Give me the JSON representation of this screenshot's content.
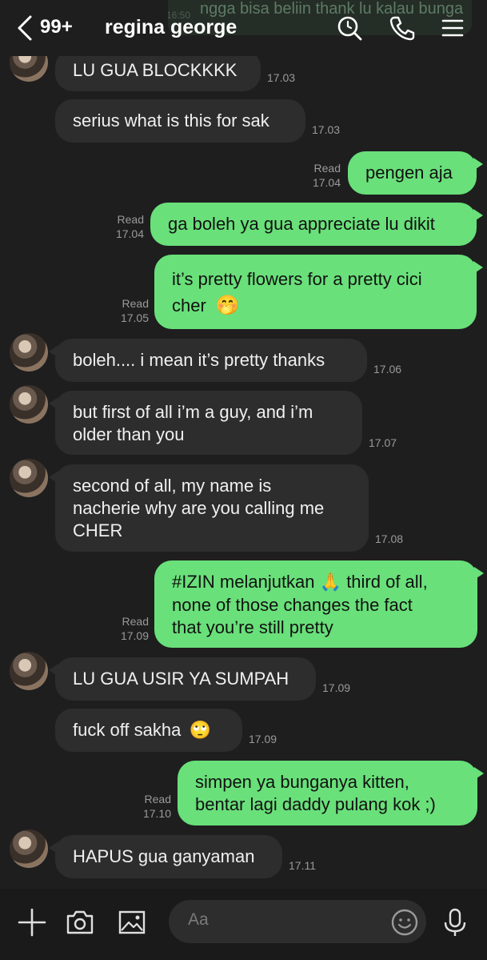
{
  "header": {
    "unread_count": "99+",
    "contact_name": "regina george",
    "partial_message": "ngga bisa beliin thank lu kalau bunga",
    "partial_time": "16:50"
  },
  "messages": [
    {
      "side": "in",
      "text": "LU GUA BLOCKKKK",
      "time": "17.03"
    },
    {
      "side": "in",
      "text": "serius what is this for sak",
      "time": "17.03"
    },
    {
      "side": "out",
      "text": "pengen aja",
      "read": "Read",
      "time": "17.04"
    },
    {
      "side": "out",
      "text": "ga boleh ya gua appreciate lu dikit",
      "read": "Read",
      "time": "17.04"
    },
    {
      "side": "out",
      "line1": "it’s pretty flowers for a pretty cici",
      "line2": "cher",
      "emoji": "🤭",
      "read": "Read",
      "time": "17.05"
    },
    {
      "side": "in",
      "text": "boleh.... i mean it’s pretty thanks",
      "time": "17.06"
    },
    {
      "side": "in",
      "line1": "but first of all i’m a guy, and i’m",
      "line2": "older than you",
      "time": "17.07"
    },
    {
      "side": "in",
      "line1": "second of all, my name is",
      "line2": "nacherie why are you calling me",
      "line3": "CHER",
      "time": "17.08"
    },
    {
      "side": "out",
      "line1a": "#IZIN melanjutkan",
      "emoji": "🙏",
      "line1b": "third of all,",
      "line2": "none of those changes the fact",
      "line3": "that you’re still pretty",
      "read": "Read",
      "time": "17.09"
    },
    {
      "side": "in",
      "text": "LU GUA USIR YA SUMPAH",
      "time": "17.09"
    },
    {
      "side": "in",
      "text": "fuck off sakha",
      "emoji": "🙄",
      "time": "17.09"
    },
    {
      "side": "out",
      "line1": "simpen ya bunganya kitten,",
      "line2": "bentar lagi daddy pulang kok ;)",
      "read": "Read",
      "time": "17.10"
    },
    {
      "side": "in",
      "text": "HAPUS gua ganyaman",
      "time": "17.11"
    }
  ],
  "input": {
    "placeholder": "Aa"
  },
  "icons": {
    "back": "chevron-left-icon",
    "search": "search-icon",
    "call": "phone-icon",
    "menu": "menu-icon",
    "plus": "plus-icon",
    "camera": "camera-icon",
    "gallery": "image-icon",
    "sticker": "smiley-icon",
    "mic": "microphone-icon"
  },
  "colors": {
    "background": "#1e1e1f",
    "incoming_bubble": "#2d2d2e",
    "outgoing_bubble": "#69e07a"
  }
}
